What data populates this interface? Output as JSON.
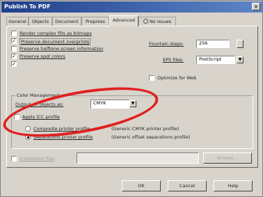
{
  "window": {
    "title": "Publish To PDF",
    "close_glyph": "×"
  },
  "tabs": [
    {
      "label": "General"
    },
    {
      "label": "Objects"
    },
    {
      "label": "Document"
    },
    {
      "label": "Prepress"
    },
    {
      "label": "Advanced"
    },
    {
      "label": "No Issues"
    }
  ],
  "options": {
    "render_fills": "Render complex fills as bitmaps",
    "preserve_overprints": "Preserve document overprints",
    "preserve_halftone": "Preserve halftone screen information",
    "preserve_spot_colors": "Preserve spot colors",
    "spot_colors_check": "✓",
    "overprints_check": "✓",
    "spot_check2": "✓",
    "fountain_steps_label": "Fountain steps:",
    "fountain_steps_value": "256",
    "eps_files_label": "EPS files:",
    "eps_files_value": "PostScript",
    "optimize_label": "Optimize for Web"
  },
  "color_management": {
    "heading": "Color Management",
    "output_label": "Output all objects as:",
    "output_value": "CMYK",
    "apply_icc_label": "Apply ICC profile",
    "composite_label": "Composite printer profile",
    "composite_desc": "(Generic CMYK printer profile)",
    "separations_label": "Separations printer profile",
    "separations_desc": "(Generic offset separations profile)"
  },
  "embedded": {
    "label": "Embedded files",
    "browse_label": "Browse..."
  },
  "footer": {
    "ok_label": "OK",
    "cancel_label": "Cancel",
    "help_label": "Help"
  },
  "colors": {
    "annotation": "#e02020",
    "titlebar": "#1f3f8a"
  }
}
